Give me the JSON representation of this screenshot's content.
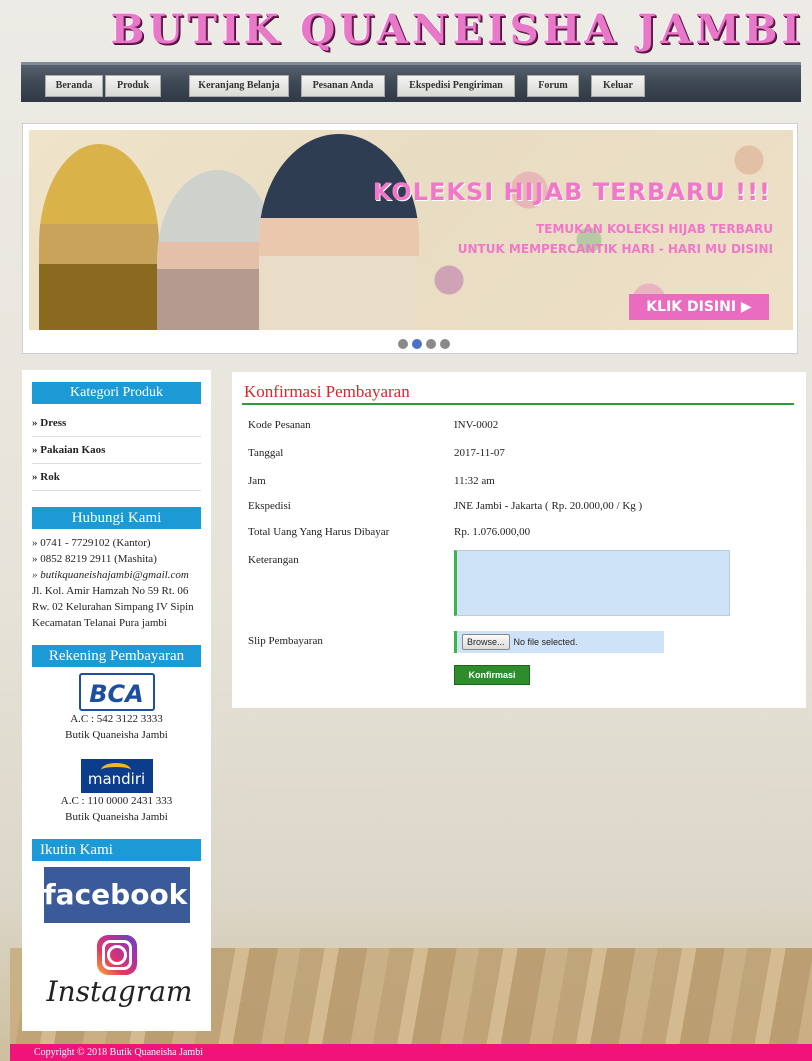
{
  "site": {
    "title": "BUTIK QUANEISHA JAMBI"
  },
  "nav": [
    {
      "label": "Beranda"
    },
    {
      "label": "Produk"
    },
    {
      "label": "Keranjang Belanja"
    },
    {
      "label": "Pesanan Anda"
    },
    {
      "label": "Ekspedisi Pengiriman"
    },
    {
      "label": "Forum"
    },
    {
      "label": "Keluar"
    }
  ],
  "banner": {
    "headline": "KOLEKSI HIJAB TERBARU !!!",
    "line1": "TEMUKAN KOLEKSI HIJAB TERBARU",
    "line2": "UNTUK MEMPERCANTIK HARI - HARI MU DISINI",
    "button": "KLIK DISINI",
    "slide_count": 4,
    "active_slide": 2
  },
  "sidebar": {
    "kategori_title": "Kategori Produk",
    "kategori": [
      "» Dress",
      "» Pakaian Kaos",
      "» Rok"
    ],
    "hubungi_title": "Hubungi Kami",
    "phone1": "» 0741 - 7729102 (Kantor)",
    "phone2": "» 0852 8219 2911 (Mashita)",
    "email": "» butikquaneishajambi@gmail.com",
    "address": "Jl. Kol. Amir Hamzah No 59 Rt. 06 Rw. 02 Kelurahan Simpang IV Sipin Kecamatan Telanai Pura jambi",
    "rekening_title": "Rekening Pembayaran",
    "bca_logo": "BCA",
    "bca_account": "A.C : 542 3122 3333",
    "bca_name": "Butik Quaneisha Jambi",
    "mandiri_logo": "mandiri",
    "mandiri_account": "A.C : 110 0000 2431 333",
    "mandiri_name": "Butik Quaneisha Jambi",
    "ikuti_title": "Ikutin Kami",
    "facebook": "facebook.",
    "instagram": "Instagram"
  },
  "form": {
    "title": "Konfirmasi Pembayaran",
    "kode_label": "Kode Pesanan",
    "kode_value": "INV-0002",
    "tanggal_label": "Tanggal",
    "tanggal_value": "2017-11-07",
    "jam_label": "Jam",
    "jam_value": "11:32 am",
    "ekspedisi_label": "Ekspedisi",
    "ekspedisi_value": "JNE Jambi - Jakarta ( Rp. 20.000,00 / Kg )",
    "total_label": "Total Uang Yang Harus Dibayar",
    "total_value": "Rp. 1.076.000,00",
    "keterangan_label": "Keterangan",
    "slip_label": "Slip Pembayaran",
    "browse_label": "Browse...",
    "file_status": "No file selected.",
    "submit_label": "Konfirmasi"
  },
  "footer": {
    "text": "Copyright © 2018 Butik Quaneisha Jambi"
  },
  "colors": {
    "accent_pink": "#f0137a",
    "sidebar_header": "#1c9ad6",
    "form_title": "#d8262d",
    "green": "#2e9b3e"
  }
}
